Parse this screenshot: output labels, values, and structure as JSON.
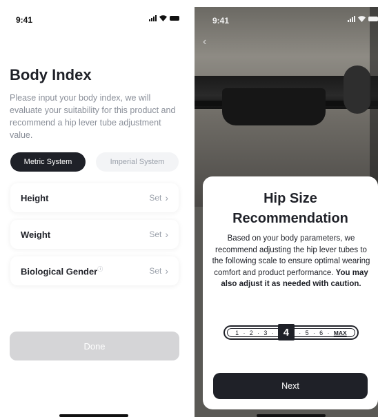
{
  "left": {
    "status": {
      "time": "9:41"
    },
    "title": "Body Index",
    "description": "Please input your body index, we will evaluate your suitability for this product and recommend a hip lever tube adjustment value.",
    "units": {
      "metric": "Metric System",
      "imperial": "Imperial System",
      "selected": "Metric System"
    },
    "rows": [
      {
        "label": "Height",
        "action": "Set"
      },
      {
        "label": "Weight",
        "action": "Set"
      },
      {
        "label": "Biological Gender",
        "action": "Set",
        "info_icon": "info-icon"
      }
    ],
    "done": "Done"
  },
  "right": {
    "status": {
      "time": "9:41"
    },
    "sheet": {
      "title_line1": "Hip Size",
      "title_line2": "Recommendation",
      "body": "Based on your body parameters, we recommend adjusting the hip lever tubes to the following scale to ensure optimal wearing comfort and product performance. ",
      "body_bold": "You may also adjust it as needed with caution.",
      "scale": [
        "1",
        "2",
        "3",
        "4",
        "5",
        "6",
        "MAX"
      ],
      "selected": "4",
      "next": "Next"
    }
  },
  "colors": {
    "primary": "#1f2128",
    "muted": "#9aa0aa",
    "disabled": "#d5d5d7"
  }
}
